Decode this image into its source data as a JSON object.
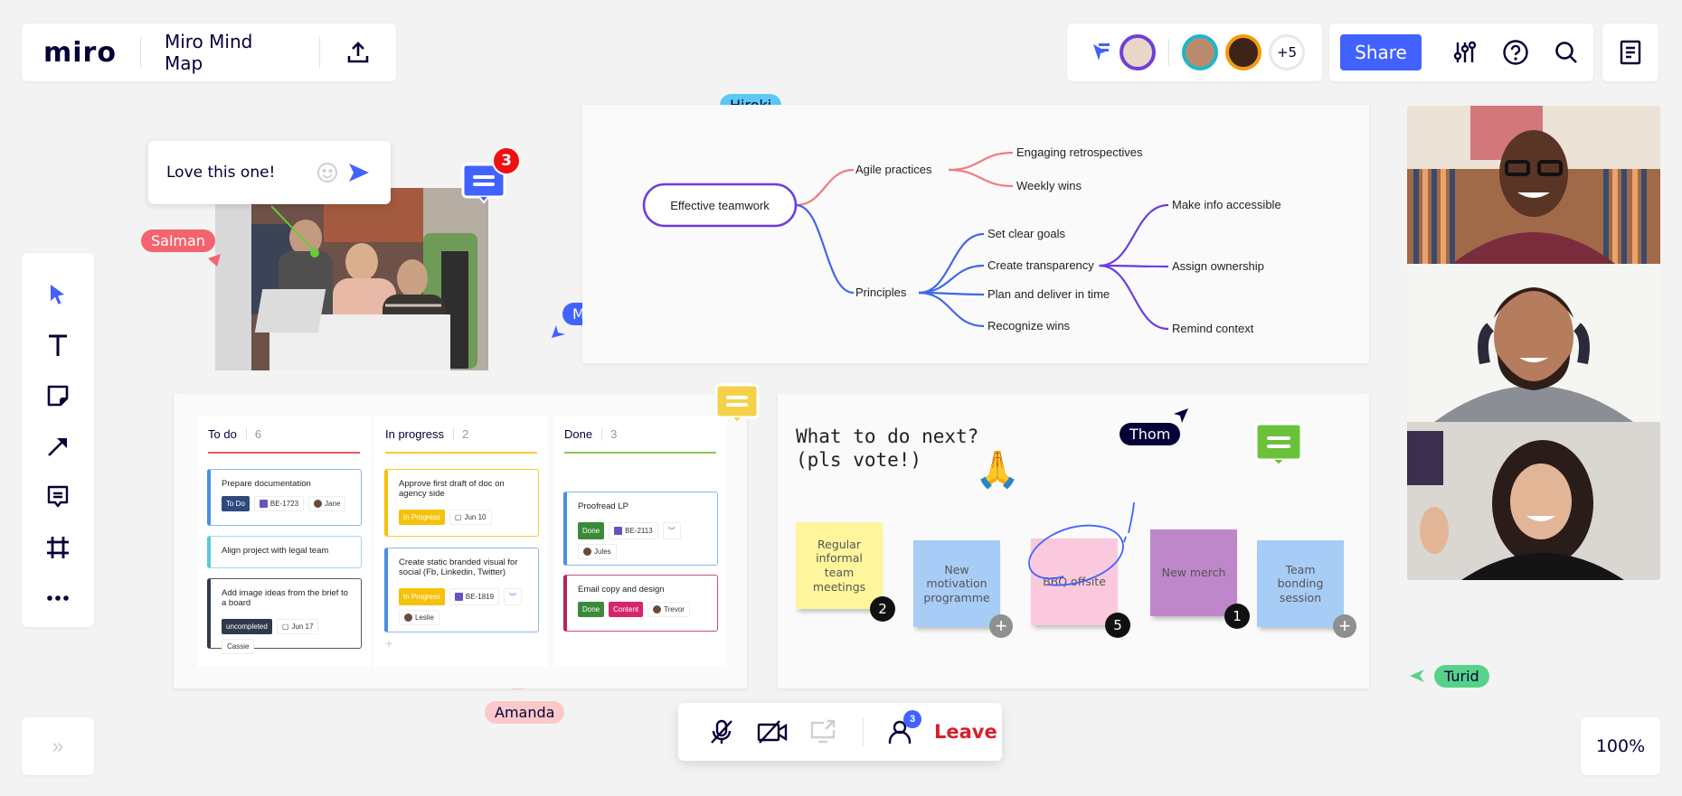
{
  "app": {
    "logo": "miro",
    "board_title": "Miro Mind Map"
  },
  "header": {
    "collaborators": [
      {
        "name": "collaborator-1",
        "ring_color": "#6e3fd8",
        "skin": "#d9b39a"
      },
      {
        "name": "collaborator-2",
        "ring_color": "#1ab8c9",
        "skin": "#c99a80"
      },
      {
        "name": "collaborator-3",
        "ring_color": "#f59a0b",
        "skin": "#5a3424"
      }
    ],
    "more_count": "+5",
    "share_label": "Share"
  },
  "comment_input": {
    "value": "Love this one!"
  },
  "comment_badges": [
    {
      "count": "3",
      "color": "#4262ff"
    }
  ],
  "cursors": [
    {
      "name": "Salman",
      "color": "#f2646e",
      "text_color": "#ffffff"
    },
    {
      "name": "Matt",
      "color": "#4262ff",
      "text_color": "#ffffff"
    },
    {
      "name": "Hiroki",
      "color": "#5cc8f5",
      "text_color": "#050038"
    },
    {
      "name": "Thom",
      "color": "#050038",
      "text_color": "#ffffff"
    },
    {
      "name": "Amanda",
      "color": "#fbc9c9",
      "text_color": "#050038"
    },
    {
      "name": "Turid",
      "color": "#57d28a",
      "text_color": "#050038"
    }
  ],
  "mindmap": {
    "root": "Effective teamwork",
    "branches": [
      {
        "label": "Agile practices",
        "color": "#f27b82",
        "children": [
          "Engaging retrospectives",
          "Weekly wins"
        ]
      },
      {
        "label": "Principles",
        "color": "#4167e8",
        "children": [
          "Set clear goals",
          "Create transparency",
          "Plan and deliver in time",
          "Recognize wins"
        ]
      }
    ],
    "sub_branch": {
      "parent": "Create transparency",
      "color": "#6c3be0",
      "children": [
        "Make info accessible",
        "Assign ownership",
        "Remind context"
      ]
    }
  },
  "kanban": {
    "columns": [
      {
        "title": "To do",
        "count": "6",
        "color": "#e0595f"
      },
      {
        "title": "In progress",
        "count": "2",
        "color": "#f5cc2f"
      },
      {
        "title": "Done",
        "count": "3",
        "color": "#8cc75a"
      }
    ],
    "cards": [
      {
        "title": "Prepare documentation",
        "status": "To Do",
        "issue": "BE-1723",
        "assignee": "Jane"
      },
      {
        "title": "Align project with legal team"
      },
      {
        "title": "Add image ideas from the brief to a board",
        "status": "uncompleted",
        "date": "Jun 17",
        "assignee": "Cassie"
      },
      {
        "title": "Approve first draft of doc on agency side",
        "status": "In Progress",
        "date": "Jun 10"
      },
      {
        "title": "Create static branded visual for social (Fb, Linkedin, Twitter)",
        "status": "In Progress",
        "issue": "BE-1819",
        "assignee": "Leslie"
      },
      {
        "title": "Proofread LP",
        "status": "Done",
        "issue": "BE-2113",
        "assignee": "Jules"
      },
      {
        "title": "Email copy and design",
        "status": "Done",
        "tag": "Content",
        "assignee": "Trevor"
      }
    ],
    "add_label": "+"
  },
  "vote": {
    "title_line1": "What to do next?",
    "title_line2": "(pls vote!)",
    "emoji": "🙏",
    "stickies": [
      {
        "text": "Regular informal team meetings",
        "color": "#fef59c",
        "votes": "2"
      },
      {
        "text": "New motivation programme",
        "color": "#a7ccf5",
        "votes": ""
      },
      {
        "text": "BBQ offsite",
        "color": "#fbc9dd",
        "votes": "5"
      },
      {
        "text": "New merch",
        "color": "#bd87c9",
        "votes": "1"
      },
      {
        "text": "Team bonding session",
        "color": "#a7ccf5",
        "votes": ""
      }
    ]
  },
  "video_participants": [
    "participant-1",
    "participant-2",
    "participant-3"
  ],
  "callbar": {
    "participants_count": "3",
    "leave_label": "Leave"
  },
  "zoom_level": "100%",
  "expand_label": "»"
}
